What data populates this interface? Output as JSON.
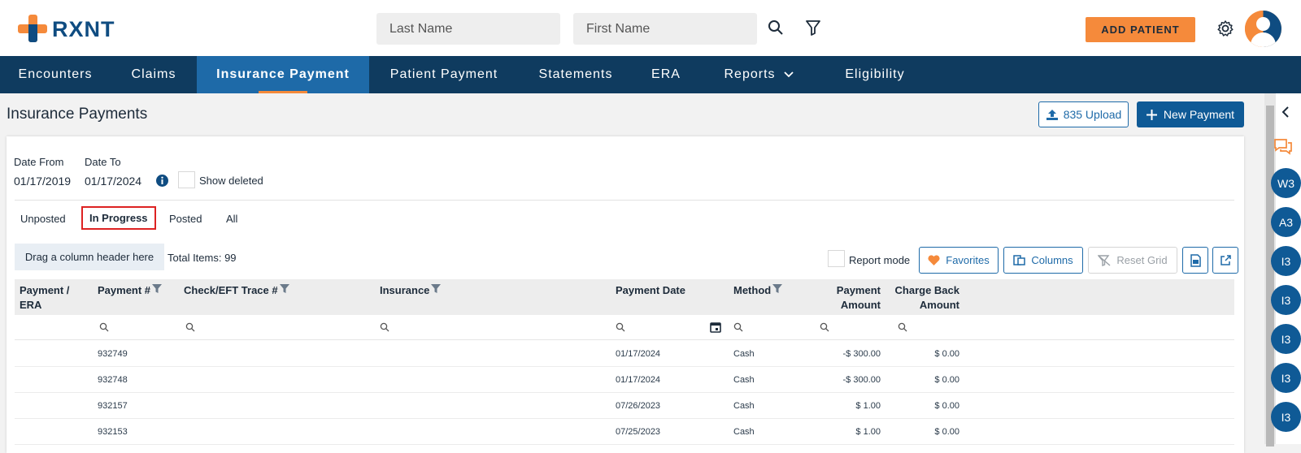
{
  "header": {
    "logo_text": "RXNT",
    "last_name_placeholder": "Last Name",
    "first_name_placeholder": "First Name",
    "add_patient_label": "ADD PATIENT"
  },
  "nav": {
    "items": [
      {
        "label": "Encounters"
      },
      {
        "label": "Claims"
      },
      {
        "label": "Insurance Payment"
      },
      {
        "label": "Patient Payment"
      },
      {
        "label": "Statements"
      },
      {
        "label": "ERA"
      },
      {
        "label": "Reports"
      },
      {
        "label": "Eligibility"
      }
    ],
    "active": "Insurance Payment"
  },
  "page": {
    "title": "Insurance Payments",
    "upload_label": "835 Upload",
    "new_payment_label": "New Payment"
  },
  "filters": {
    "date_from_label": "Date From",
    "date_from_value": "01/17/2019",
    "date_to_label": "Date To",
    "date_to_value": "01/17/2024",
    "show_deleted_label": "Show deleted"
  },
  "tabs": [
    "Unposted",
    "In Progress",
    "Posted",
    "All"
  ],
  "grid": {
    "drag_hint": "Drag a column header here",
    "total_items": "Total Items: 99",
    "report_mode_label": "Report mode",
    "favorites_label": "Favorites",
    "columns_label": "Columns",
    "reset_grid_label": "Reset Grid",
    "headers": {
      "payment_era_1": "Payment /",
      "payment_era_2": "ERA",
      "payment_no": "Payment #",
      "check_eft": "Check/EFT Trace #",
      "insurance": "Insurance",
      "payment_date": "Payment Date",
      "method": "Method",
      "payment_amount_1": "Payment",
      "payment_amount_2": "Amount",
      "chargeback_1": "Charge Back",
      "chargeback_2": "Amount"
    },
    "rows": [
      {
        "payment_no": "932749",
        "payment_date": "01/17/2024",
        "method": "Cash",
        "amount": "-$ 300.00",
        "chargeback": "$ 0.00"
      },
      {
        "payment_no": "932748",
        "payment_date": "01/17/2024",
        "method": "Cash",
        "amount": "-$ 300.00",
        "chargeback": "$ 0.00"
      },
      {
        "payment_no": "932157",
        "payment_date": "07/26/2023",
        "method": "Cash",
        "amount": "$ 1.00",
        "chargeback": "$ 0.00"
      },
      {
        "payment_no": "932153",
        "payment_date": "07/25/2023",
        "method": "Cash",
        "amount": "$ 1.00",
        "chargeback": "$ 0.00"
      }
    ]
  },
  "side_badges": [
    "W3",
    "A3",
    "I3",
    "I3",
    "I3",
    "I3",
    "I3"
  ],
  "colors": {
    "brand_orange": "#f58a3b",
    "brand_blue": "#0f4c81",
    "nav_bg": "#0f3b5f",
    "nav_active": "#1e6aa8"
  }
}
